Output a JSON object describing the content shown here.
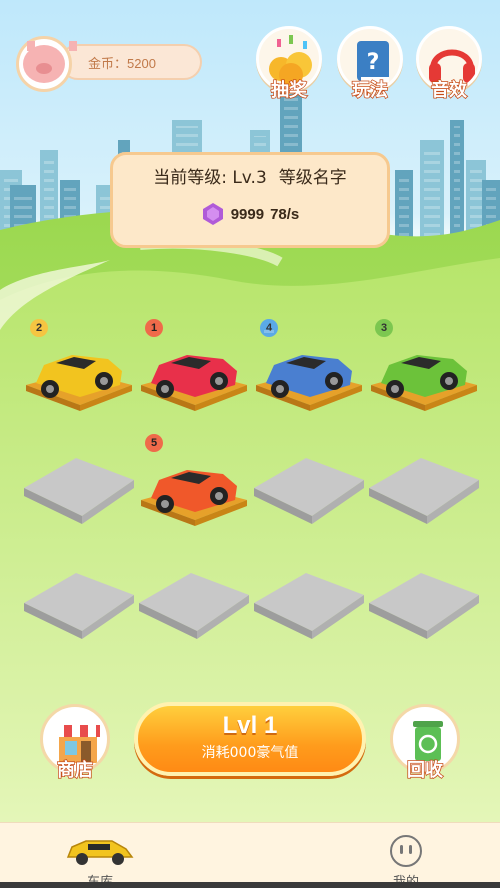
{
  "header": {
    "coin_label": "金币：5200",
    "buttons": [
      {
        "label": "抽奖",
        "icon": "lottery-coins-icon"
      },
      {
        "label": "玩法",
        "icon": "help-book-icon"
      },
      {
        "label": "音效",
        "icon": "headphones-icon"
      }
    ]
  },
  "level_panel": {
    "current_level": "当前等级: Lv.3",
    "level_name": "等级名字",
    "gems": "9999",
    "rate": "78/s"
  },
  "garage": {
    "rows": [
      [
        {
          "level": "2",
          "color": "#f2c41f",
          "badge": "y"
        },
        {
          "level": "1",
          "color": "#e8304a",
          "badge": "r"
        },
        {
          "level": "4",
          "color": "#4a7fd0",
          "badge": "b"
        },
        {
          "level": "3",
          "color": "#6cc23a",
          "badge": "g"
        }
      ],
      [
        null,
        {
          "level": "5",
          "color": "#f0582a",
          "badge": "r"
        },
        null,
        null
      ],
      [
        null,
        null,
        null,
        null
      ]
    ]
  },
  "controls": {
    "shop_label": "商店",
    "recycle_label": "回收",
    "upgrade_title": "Lvl 1",
    "upgrade_subtitle": "消耗000豪气值"
  },
  "tabbar": {
    "tabs": [
      {
        "label": "车库",
        "icon": "car-icon"
      },
      {
        "label": "我的",
        "icon": "profile-face-icon"
      }
    ]
  },
  "colors": {
    "accent_orange": "#ff9c1c",
    "panel": "#fde8c9",
    "grass": "#8fd04a"
  }
}
